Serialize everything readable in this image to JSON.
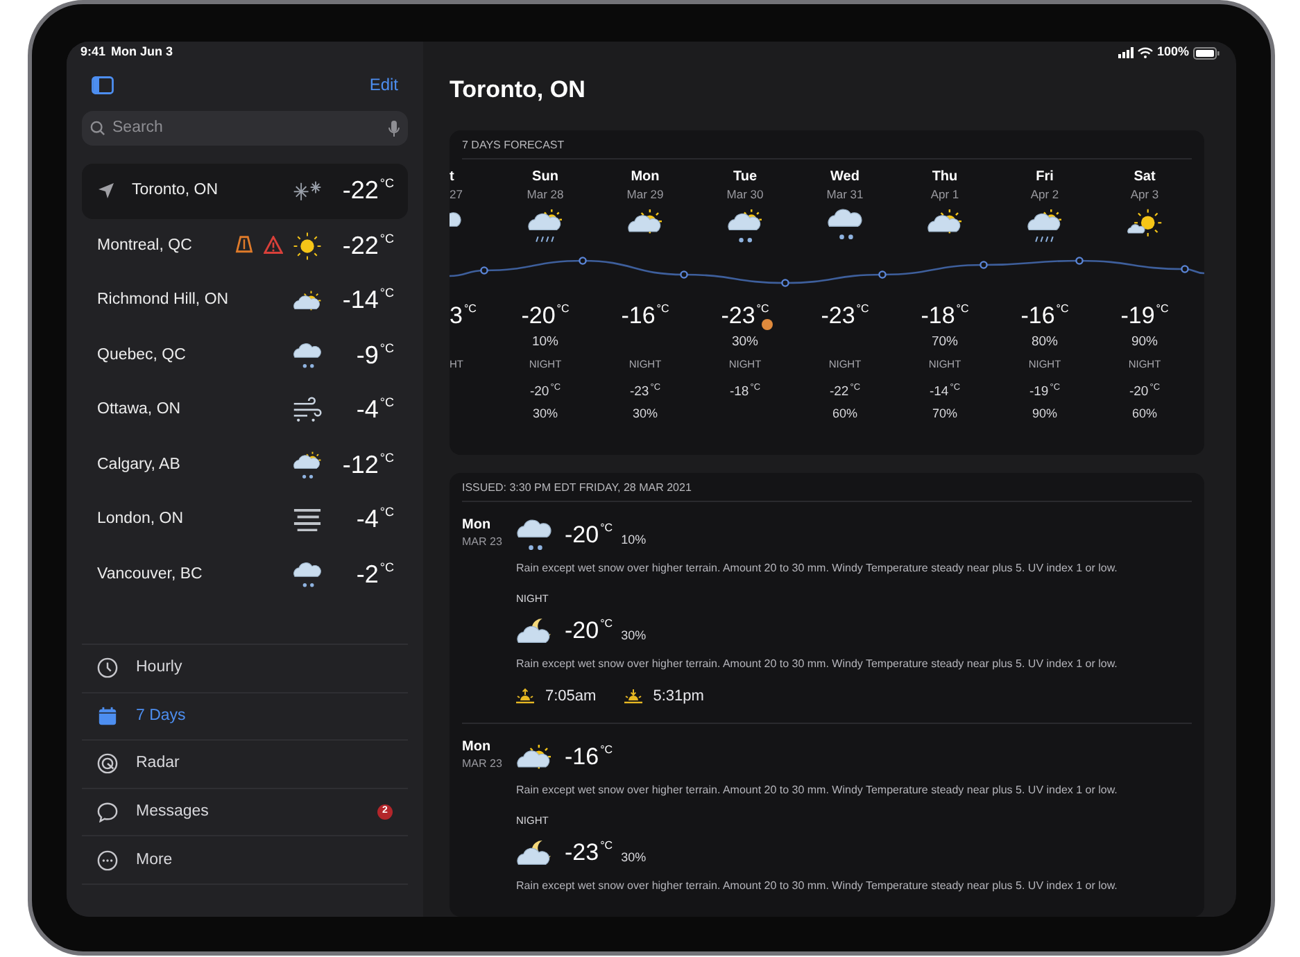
{
  "status_bar": {
    "time": "9:41",
    "date": "Mon Jun 3",
    "battery": "100%"
  },
  "sidebar": {
    "edit": "Edit",
    "search": {
      "placeholder": "Search"
    },
    "locations": [
      {
        "name": "Toronto, ON",
        "temp": "-22$^{°C}$",
        "kind": "flakes",
        "current": true,
        "selected": true
      },
      {
        "name": "Montreal, QC",
        "temp": "-22$^{°C}$",
        "kind": "sunny",
        "current": false,
        "selected": false,
        "alerts": [
          {
            "kind": "travel",
            "color": "#e07b2a"
          },
          {
            "kind": "warning",
            "color": "#d9403a"
          }
        ]
      },
      {
        "name": "Richmond Hill, ON",
        "temp": "-14$^{°C}$",
        "kind": "partly-cloudy",
        "current": false,
        "selected": false
      },
      {
        "name": "Quebec, QC",
        "temp": "-9$^{°C}$",
        "kind": "snow",
        "current": false,
        "selected": false
      },
      {
        "name": "Ottawa, ON",
        "temp": "-4$^{°C}$",
        "kind": "wind-snow",
        "current": false,
        "selected": false
      },
      {
        "name": "Calgary, AB",
        "temp": "-12$^{°C}$",
        "kind": "sun-snow",
        "current": false,
        "selected": false
      },
      {
        "name": "London, ON",
        "temp": "-4$^{°C}$",
        "kind": "fog",
        "current": false,
        "selected": false
      },
      {
        "name": "Vancouver, BC",
        "temp": "-2$^{°C}$",
        "kind": "snow",
        "current": false,
        "selected": false
      }
    ],
    "nav": [
      {
        "label": "Hourly",
        "selected": false
      },
      {
        "label": "7 Days",
        "selected": true
      },
      {
        "label": "Radar",
        "selected": false
      },
      {
        "label": "Messages",
        "selected": false,
        "badge": "2"
      },
      {
        "label": "More",
        "selected": false
      }
    ]
  },
  "main": {
    "title": "Toronto, ON",
    "forecast": {
      "title": "7 DAYS FORECAST",
      "days": [
        {
          "day": "t",
          "date": "27",
          "kind": "cloudy",
          "high": "3$^{°C}$",
          "warning": false,
          "night_label": "HT"
        },
        {
          "day": "Sun",
          "date": "Mar 28",
          "kind": "sun-rain",
          "high": "-20$^{°C}$",
          "warning": false,
          "precip": "10%",
          "night_label": "NIGHT",
          "night_temp": "-20$^{°C}$",
          "night_precip": "30%"
        },
        {
          "day": "Mon",
          "date": "Mar 29",
          "kind": "partly-cloudy",
          "high": "-16$^{°C}$",
          "warning": false,
          "night_label": "NIGHT",
          "night_temp": "-23$^{°C}$",
          "night_precip": "30%"
        },
        {
          "day": "Tue",
          "date": "Mar 30",
          "kind": "sun-snow",
          "high": "-23$^{°C}$",
          "warning": true,
          "precip": "30%",
          "night_label": "NIGHT",
          "night_temp": "-18$^{°C}$"
        },
        {
          "day": "Wed",
          "date": "Mar 31",
          "kind": "snow",
          "high": "-23$^{°C}$",
          "warning": false,
          "night_label": "NIGHT",
          "night_temp": "-22$^{°C}$",
          "night_precip": "60%"
        },
        {
          "day": "Thu",
          "date": "Apr 1",
          "kind": "partly-cloudy",
          "high": "-18$^{°C}$",
          "warning": false,
          "precip": "70%",
          "night_label": "NIGHT",
          "night_temp": "-14$^{°C}$",
          "night_precip": "70%"
        },
        {
          "day": "Fri",
          "date": "Apr 2",
          "kind": "sun-rain",
          "high": "-16$^{°C}$",
          "warning": false,
          "precip": "80%",
          "night_label": "NIGHT",
          "night_temp": "-19$^{°C}$",
          "night_precip": "90%"
        },
        {
          "day": "Sat",
          "date": "Apr 3",
          "kind": "sunny-cloud",
          "high": "-19$^{°C}$",
          "warning": false,
          "precip": "90%",
          "night_label": "NIGHT",
          "night_temp": "-20$^{°C}$",
          "night_precip": "60%"
        }
      ]
    },
    "details": {
      "issued": "ISSUED: 3:30 PM EDT FRIDAY, 28 MAR 2021",
      "entries": [
        {
          "day": "Mon",
          "date": "MAR 23",
          "kind": "snow",
          "temp": "-20$^{°C}$",
          "precip": "10%",
          "text": "Rain except wet snow over higher terrain. Amount 20 to 30 mm. Windy Temperature steady near plus 5. UV index 1 or low.",
          "night": {
            "label": "NIGHT",
            "kind": "night-cloudy",
            "temp": "-20$^{°C}$",
            "precip": "30%",
            "text": "Rain except wet snow over higher terrain. Amount 20 to 30 mm. Windy Temperature steady near plus 5. UV index 1 or low."
          },
          "sunrise": "7:05am",
          "sunset": "5:31pm"
        },
        {
          "day": "Mon",
          "date": "MAR 23",
          "kind": "partly-cloudy",
          "temp": "-16$^{°C}$",
          "text": "Rain except wet snow over higher terrain. Amount 20 to 30 mm. Windy Temperature steady near plus 5. UV index 1 or low.",
          "night": {
            "label": "NIGHT",
            "kind": "night-cloudy",
            "temp": "-23$^{°C}$",
            "precip": "30%",
            "text": "Rain except wet snow over higher terrain. Amount 20 to 30 mm. Windy Temperature steady near plus 5. UV index 1 or low."
          }
        }
      ]
    }
  }
}
